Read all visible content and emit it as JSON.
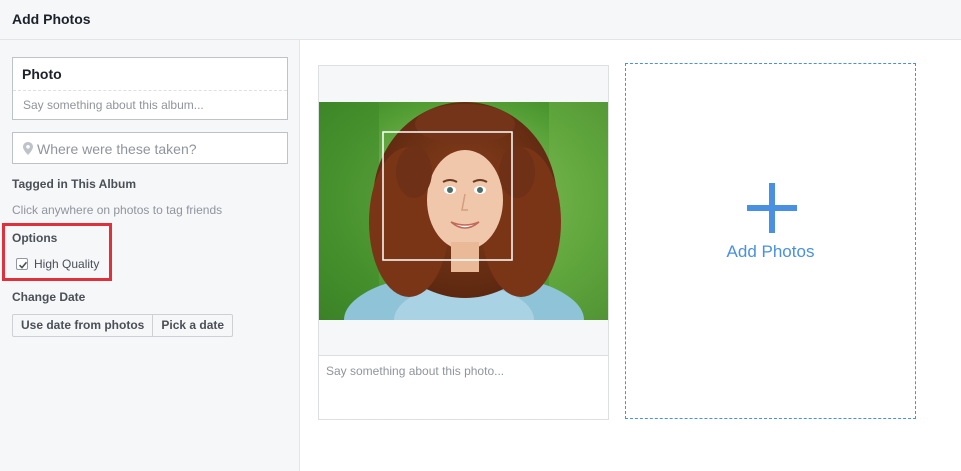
{
  "header": {
    "title": "Add Photos"
  },
  "album": {
    "title": "Photo",
    "description_placeholder": "Say something about this album..."
  },
  "location": {
    "placeholder": "Where were these taken?",
    "icon": "map-pin-icon"
  },
  "tagged": {
    "heading": "Tagged in This Album",
    "hint": "Click anywhere on photos to tag friends"
  },
  "options": {
    "heading": "Options",
    "high_quality_label": "High Quality",
    "high_quality_checked": true
  },
  "change_date": {
    "heading": "Change Date",
    "use_date_label": "Use date from photos",
    "pick_date_label": "Pick a date"
  },
  "photo": {
    "caption_placeholder": "Say something about this photo..."
  },
  "add_photos": {
    "label": "Add Photos",
    "icon": "plus-icon",
    "accent": "#4a90e2"
  },
  "colors": {
    "highlight": "#e0303b",
    "accent": "#4a90e2"
  }
}
